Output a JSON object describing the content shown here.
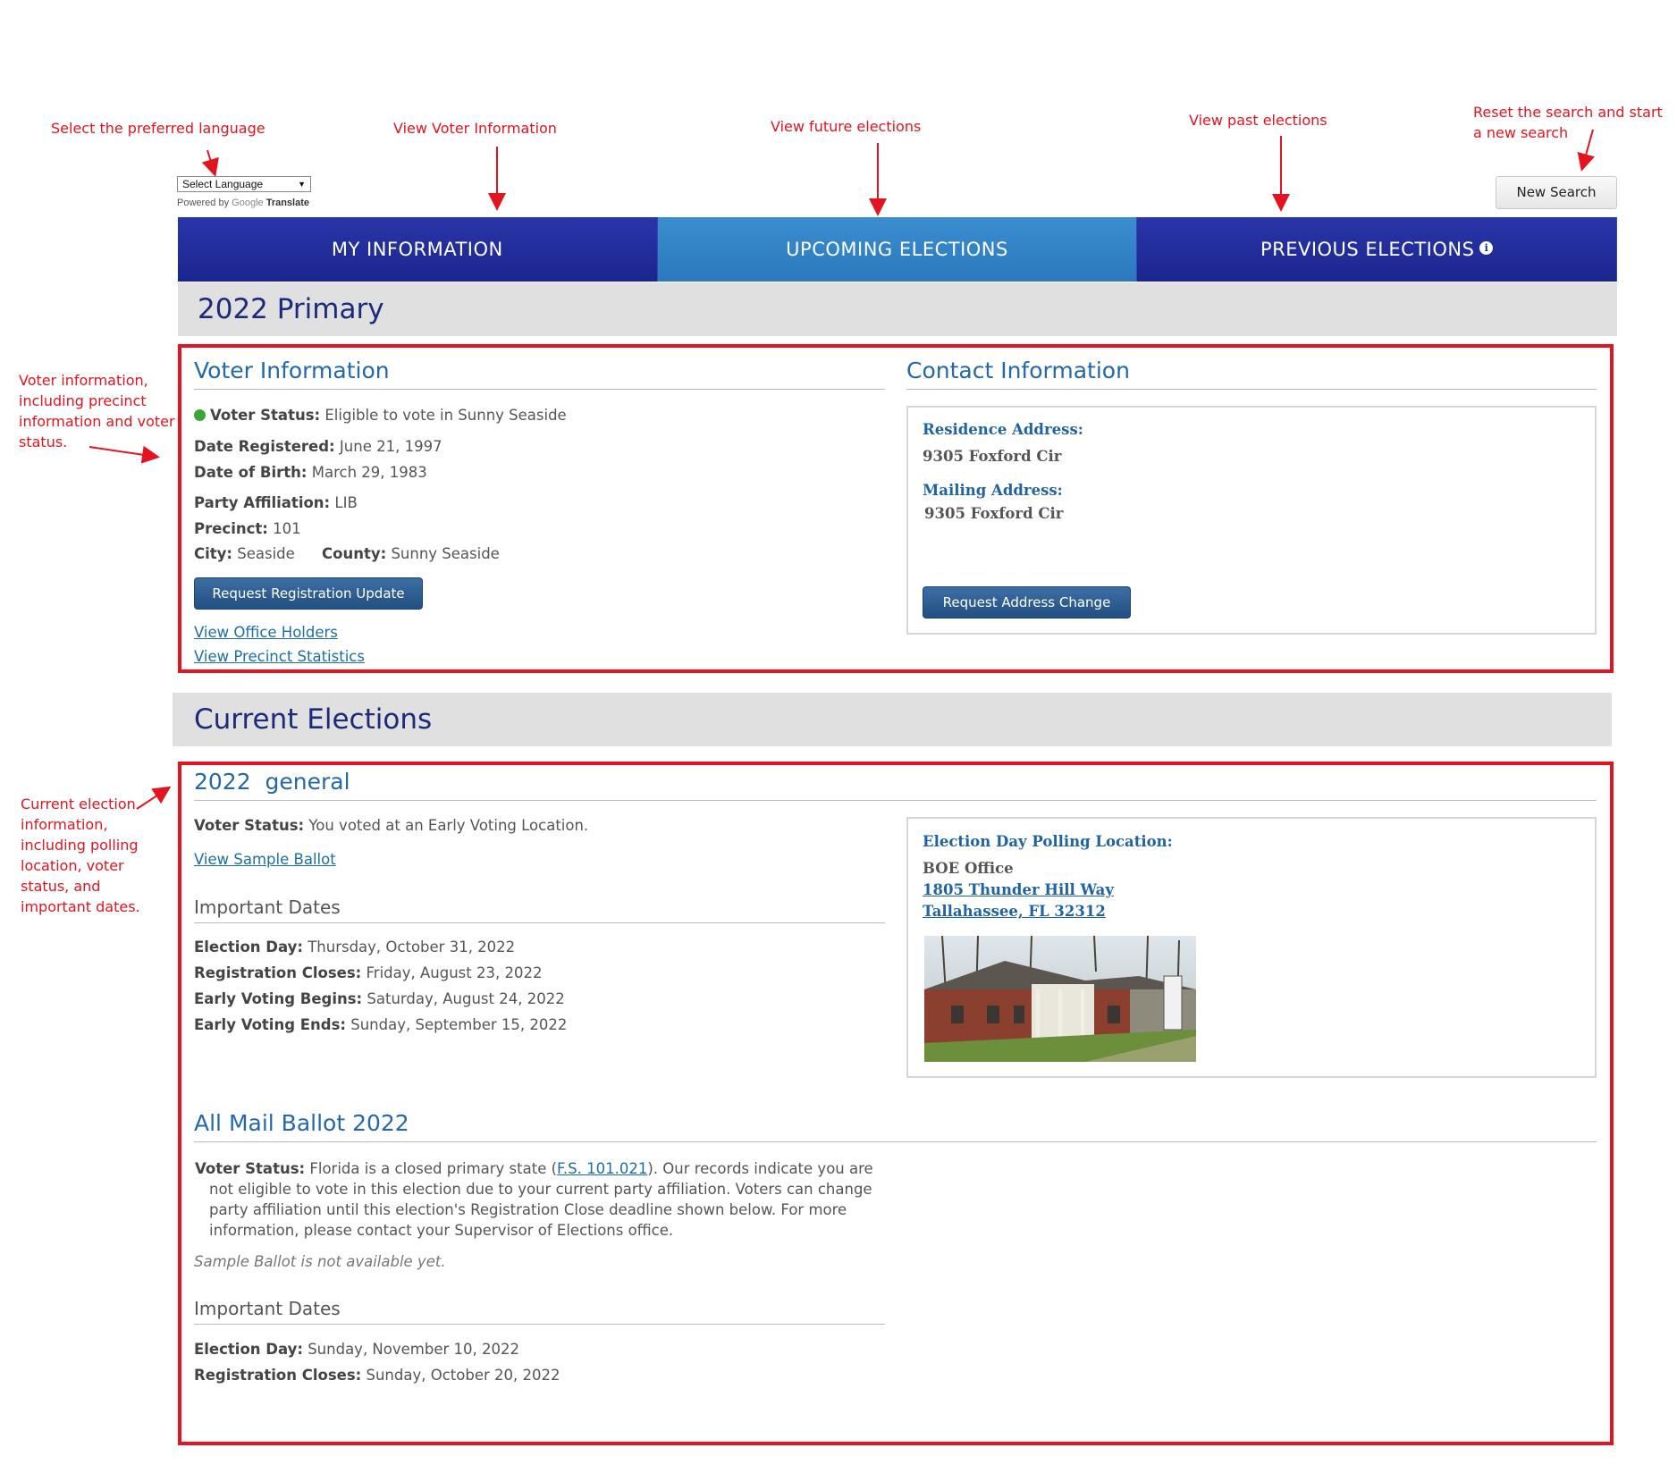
{
  "annotations": {
    "language": "Select the preferred language",
    "voter_info": "View Voter Information",
    "future": "View future elections",
    "past": "View past elections",
    "reset": [
      "Reset the search and start",
      "a new search"
    ],
    "left_voter": [
      "Voter information,",
      "including precinct",
      "information and voter",
      "status."
    ],
    "left_current": [
      "Current election",
      "information,",
      "including polling",
      "location, voter",
      "status, and",
      "important dates."
    ]
  },
  "language_widget": {
    "select_label": "Select Language",
    "powered_by": "Powered by",
    "google": "Google",
    "translate": "Translate"
  },
  "new_search_label": "New Search",
  "nav": {
    "tabs": [
      "MY INFORMATION",
      "UPCOMING ELECTIONS",
      "PREVIOUS ELECTIONS"
    ],
    "active_tab": "UPCOMING ELECTIONS"
  },
  "primary_title": "2022 Primary",
  "voter_information": {
    "heading": "Voter Information",
    "status_label": "Voter Status:",
    "status_value": "Eligible to vote in Sunny Seaside",
    "date_registered_label": "Date Registered:",
    "date_registered_value": "June 21, 1997",
    "dob_label": "Date of Birth:",
    "dob_value": "March 29, 1983",
    "party_label": "Party Affiliation:",
    "party_value": "LIB",
    "precinct_label": "Precinct:",
    "precinct_value": "101",
    "city_label": "City:",
    "city_value": "Seaside",
    "county_label": "County:",
    "county_value": "Sunny Seaside",
    "update_button": "Request Registration Update",
    "office_holders_link": "View Office Holders",
    "precinct_stats_link": "View Precinct Statistics"
  },
  "contact_information": {
    "heading": "Contact Information",
    "residence_label": "Residence Address:",
    "residence_value": "9305 Foxford Cir",
    "mailing_label": "Mailing Address:",
    "mailing_value": "9305 Foxford Cir",
    "address_button": "Request Address Change"
  },
  "current_elections": {
    "title": "Current Elections",
    "general": {
      "year": "2022",
      "name": "general",
      "status_label": "Voter Status:",
      "status_value": "You voted at an Early Voting Location.",
      "sample_ballot_link": "View Sample Ballot",
      "dates_heading": "Important Dates",
      "dates": [
        {
          "label": "Election Day:",
          "value": "Thursday, October 31, 2022"
        },
        {
          "label": "Registration Closes:",
          "value": "Friday, August 23, 2022"
        },
        {
          "label": "Early Voting Begins:",
          "value": "Saturday, August 24, 2022"
        },
        {
          "label": "Early Voting Ends:",
          "value": "Sunday, September 15, 2022"
        }
      ],
      "polling_label": "Election Day Polling Location:",
      "polling_name": "BOE Office",
      "polling_address1": "1805 Thunder Hill Way",
      "polling_address2": "Tallahassee, FL 32312"
    },
    "mail": {
      "heading": "All Mail Ballot 2022",
      "status_label": "Voter Status:",
      "status_pre": "Florida is a closed primary state (",
      "statute_link": "F.S. 101.021",
      "status_line1_post": "). Our records indicate you are",
      "status_line2": "not eligible to vote in this election due to your current party affiliation. Voters can change",
      "status_line3": "party affiliation until this election's Registration Close deadline shown below. For more",
      "status_line4": "information, please contact your Supervisor of Elections office.",
      "sample_note": "Sample Ballot is not available yet.",
      "dates_heading": "Important Dates",
      "dates": [
        {
          "label": "Election Day:",
          "value": "Sunday, November 10, 2022"
        },
        {
          "label": "Registration Closes:",
          "value": "Sunday, October 20, 2022"
        }
      ]
    }
  }
}
